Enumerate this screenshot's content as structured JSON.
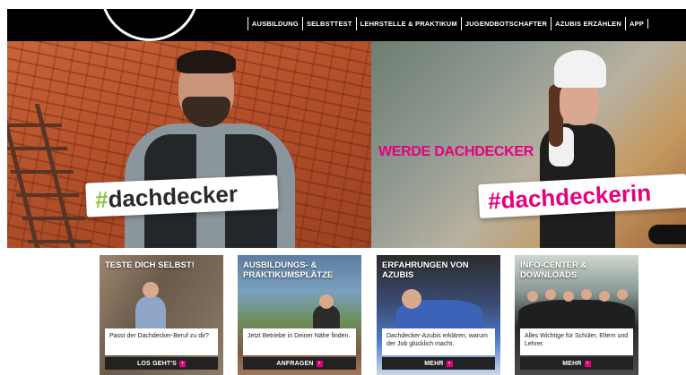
{
  "nav": {
    "items": [
      {
        "label": "AUSBILDUNG"
      },
      {
        "label": "SELBSTTEST"
      },
      {
        "label": "LEHRSTELLE & PRAKTIKUM"
      },
      {
        "label": "JUGENDBOTSCHAFTER"
      },
      {
        "label": "AZUBIS ERZÄHLEN"
      },
      {
        "label": "APP"
      }
    ]
  },
  "hero": {
    "headline": "WERDE DACHDECKER",
    "hashtag_left": {
      "hash": "#",
      "word": "dachdecker"
    },
    "hashtag_right": {
      "hash": "#",
      "word": "dachdeckerin"
    }
  },
  "cards": [
    {
      "title": "TESTE DICH SELBST!",
      "text": "Passt der Dachdecker-Beruf zu dir?",
      "button": "LOS GEHT'S"
    },
    {
      "title": "AUSBILDUNGS- & PRAKTIKUMSPLÄTZE",
      "text": "Jetzt Betriebe in Deiner Nähe finden.",
      "button": "ANFRAGEN"
    },
    {
      "title": "ERFAHRUNGEN VON AZUBIS",
      "text": "Dachdecker-Azubis erklären, warum der Job glücklich macht.",
      "button": "MEHR"
    },
    {
      "title": "INFO-CENTER & DOWNLOADS",
      "text": "Alles Wichtige für Schüler, Eltern und Lehrer.",
      "button": "MEHR"
    }
  ],
  "icons": {
    "arrow": "›"
  },
  "colors": {
    "accent": "#e6007e",
    "green": "#8cc63f",
    "header": "#000000"
  }
}
